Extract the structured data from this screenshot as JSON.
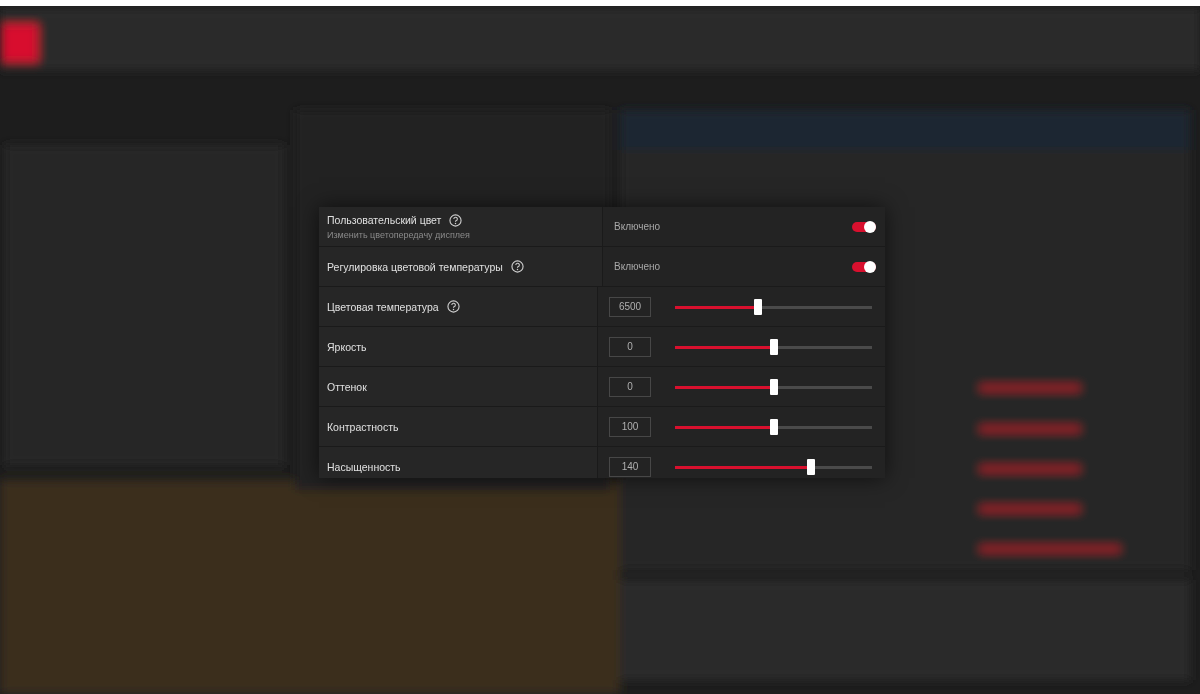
{
  "panel": {
    "rows": [
      {
        "kind": "toggle",
        "label": "Пользовательский цвет",
        "help": true,
        "description": "Изменить цветопередачу дисплея",
        "status": "Включено",
        "on": true
      },
      {
        "kind": "toggle",
        "label": "Регулировка цветовой температуры",
        "help": true,
        "status": "Включено",
        "on": true
      },
      {
        "kind": "slider",
        "label": "Цветовая температура",
        "help": true,
        "value": "6500",
        "level": 0.42
      },
      {
        "kind": "slider",
        "label": "Яркость",
        "help": false,
        "value": "0",
        "level": 0.5
      },
      {
        "kind": "slider",
        "label": "Оттенок",
        "help": false,
        "value": "0",
        "level": 0.5
      },
      {
        "kind": "slider",
        "label": "Контрастность",
        "help": false,
        "value": "100",
        "level": 0.5
      },
      {
        "kind": "slider",
        "label": "Насыщенность",
        "help": false,
        "value": "140",
        "level": 0.69
      }
    ]
  }
}
